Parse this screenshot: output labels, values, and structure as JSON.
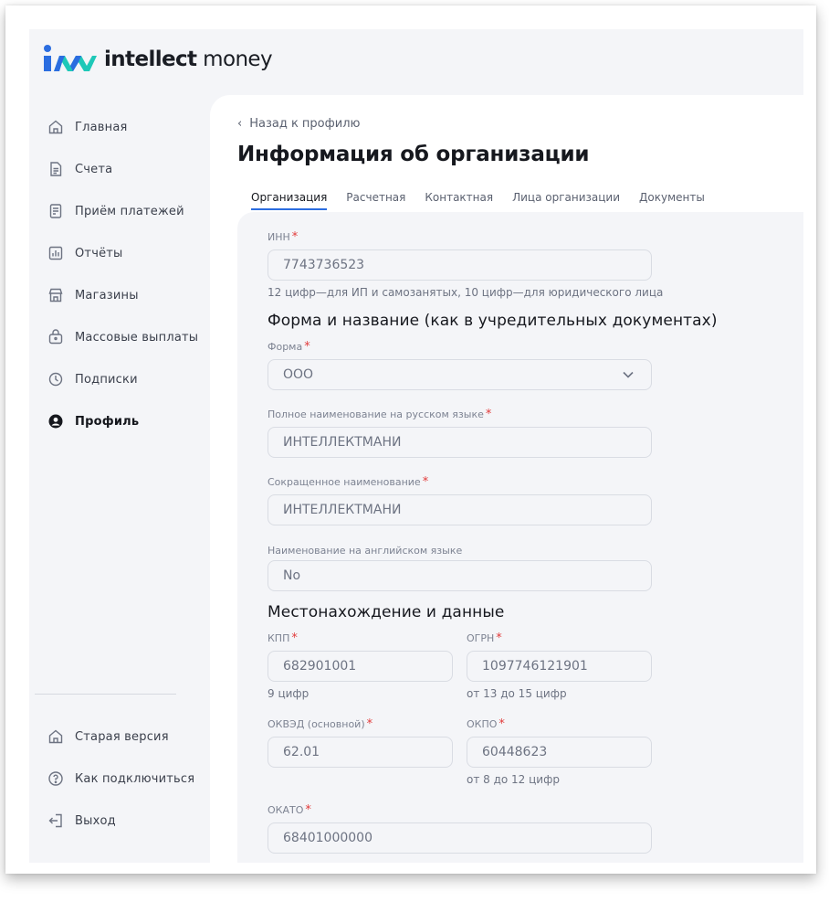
{
  "brand": {
    "logo_bold": "intellect",
    "logo_light": " money",
    "colors": {
      "blue": "#2b6de0",
      "teal": "#1ec8b8"
    }
  },
  "sidebar": {
    "items": [
      {
        "label": "Главная",
        "icon": "home-icon"
      },
      {
        "label": "Счета",
        "icon": "document-icon"
      },
      {
        "label": "Приём платежей",
        "icon": "receipt-icon"
      },
      {
        "label": "Отчёты",
        "icon": "chart-icon"
      },
      {
        "label": "Магазины",
        "icon": "store-icon"
      },
      {
        "label": "Массовые выплаты",
        "icon": "wallet-icon"
      },
      {
        "label": "Подписки",
        "icon": "clock-icon"
      },
      {
        "label": "Профиль",
        "icon": "user-icon",
        "active": true
      }
    ],
    "bottom_items": [
      {
        "label": "Старая версия",
        "icon": "home-icon"
      },
      {
        "label": "Как подключиться",
        "icon": "help-icon"
      },
      {
        "label": "Выход",
        "icon": "logout-icon"
      }
    ]
  },
  "header": {
    "back_label": "Назад к профилю",
    "title": "Информация об организации"
  },
  "tabs": [
    {
      "label": "Организация",
      "active": true
    },
    {
      "label": "Расчетная"
    },
    {
      "label": "Контактная"
    },
    {
      "label": "Лица организации"
    },
    {
      "label": "Документы"
    }
  ],
  "form": {
    "inn": {
      "label": "ИНН",
      "value": "7743736523",
      "hint": "12 цифр—для ИП и самозанятых, 10 цифр—для юридического лица"
    },
    "section_name": "Форма и название (как в учредительных документах)",
    "forma": {
      "label": "Форма",
      "value": "ООО"
    },
    "full_name": {
      "label": "Полное наименование на русском языке",
      "value": "ИНТЕЛЛЕКТМАНИ"
    },
    "short_name": {
      "label": "Сокращенное наименование",
      "value": "ИНТЕЛЛЕКТМАНИ"
    },
    "english_name": {
      "label": "Наименование на английском языке",
      "value": "No"
    },
    "section_location": "Местонахождение и данные",
    "kpp": {
      "label": "КПП",
      "value": "682901001",
      "hint": "9 цифр"
    },
    "ogrn": {
      "label": "ОГРН",
      "value": "1097746121901",
      "hint": "от 13 до 15 цифр"
    },
    "okved": {
      "label": "ОКВЭД (основной)",
      "value": "62.01"
    },
    "okpo": {
      "label": "ОКПО",
      "value": "60448623",
      "hint": "от 8 до 12 цифр"
    },
    "okato": {
      "label": "ОКАТО",
      "value": "68401000000"
    },
    "required_mark": "*"
  }
}
